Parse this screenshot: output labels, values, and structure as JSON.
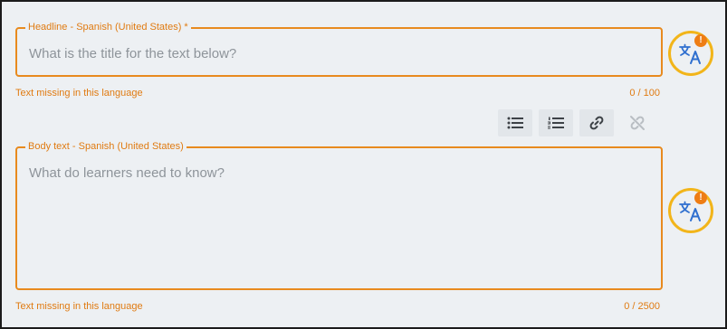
{
  "headline": {
    "label": "Headline - Spanish (United States) *",
    "placeholder": "What is the title for the text below?",
    "value": "",
    "helper": "Text missing in this language",
    "counter": "0 / 100"
  },
  "body_text": {
    "label": "Body text - Spanish (United States)",
    "placeholder": "What do learners need to know?",
    "value": "",
    "helper": "Text missing in this language",
    "counter": "0 / 2500"
  },
  "toolbar": {
    "buttons": [
      {
        "icon": "bulleted-list-icon",
        "enabled": true
      },
      {
        "icon": "numbered-list-icon",
        "enabled": true
      },
      {
        "icon": "link-icon",
        "enabled": true
      },
      {
        "icon": "unlink-icon",
        "enabled": false
      }
    ]
  },
  "translate_buttons": [
    {
      "icon": "translate-icon",
      "badge": "!"
    },
    {
      "icon": "translate-icon",
      "badge": "!"
    }
  ],
  "colors": {
    "accent": "#e88a1e",
    "highlight_ring": "#f2b51a",
    "translate_icon": "#2f6fcf",
    "background": "#edf0f3"
  }
}
